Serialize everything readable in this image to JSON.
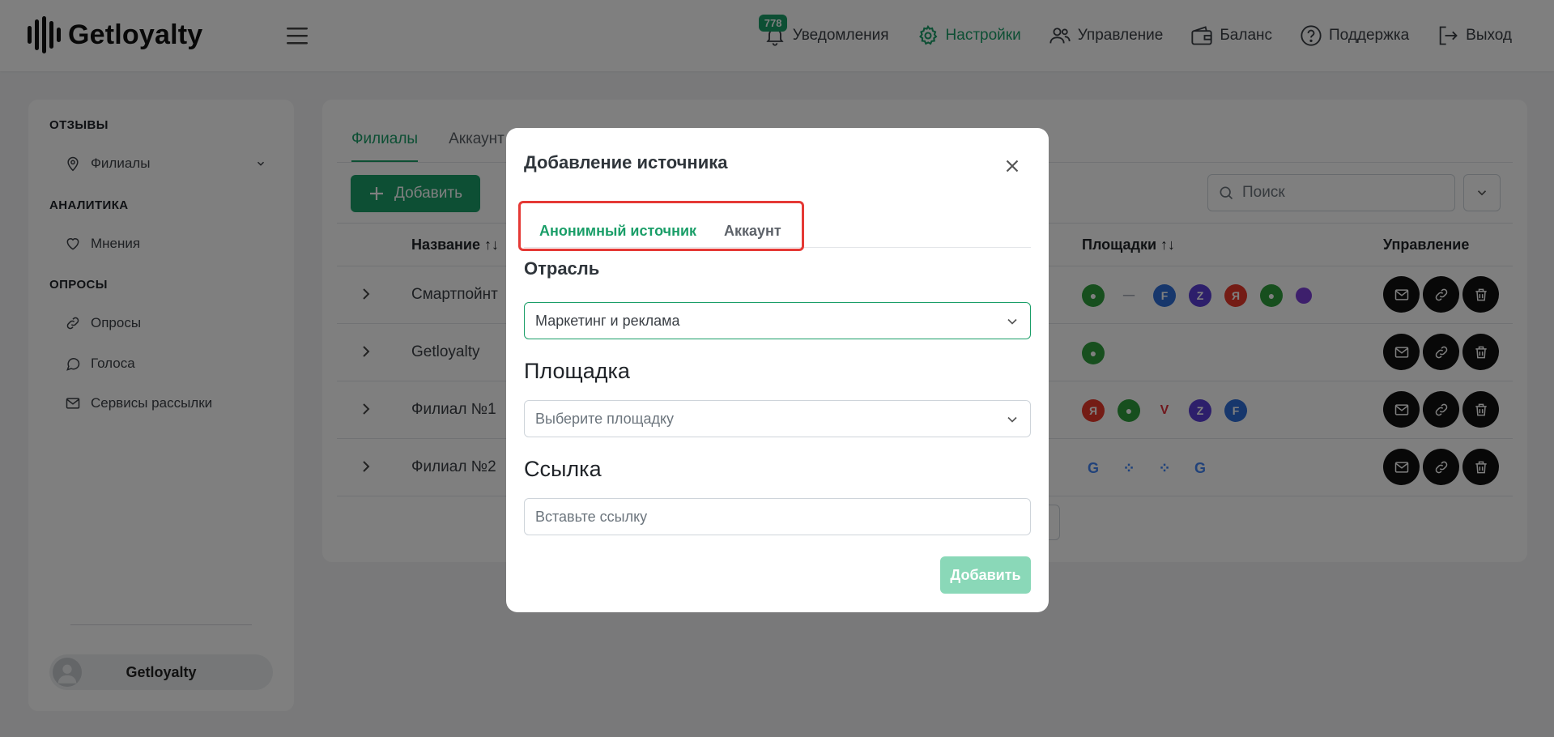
{
  "header": {
    "logo_text": "Getloyalty",
    "nav": [
      {
        "label": "Уведомления",
        "icon": "bell-icon",
        "badge": "778"
      },
      {
        "label": "Настройки",
        "icon": "gear-icon",
        "active": true
      },
      {
        "label": "Управление",
        "icon": "users-icon"
      },
      {
        "label": "Баланс",
        "icon": "wallet-icon"
      },
      {
        "label": "Поддержка",
        "icon": "help-icon"
      },
      {
        "label": "Выход",
        "icon": "logout-icon"
      }
    ]
  },
  "sidebar": {
    "sections": [
      {
        "title": "ОТЗЫВЫ",
        "items": [
          {
            "label": "Филиалы",
            "icon": "map-pin-icon"
          }
        ]
      },
      {
        "title": "АНАЛИТИКА",
        "items": [
          {
            "label": "Мнения",
            "icon": "heart-icon"
          }
        ]
      },
      {
        "title": "ОПРОСЫ",
        "items": [
          {
            "label": "Опросы",
            "icon": "link-icon"
          },
          {
            "label": "Голоса",
            "icon": "chat-icon"
          },
          {
            "label": "Сервисы рассылки",
            "icon": "mail-icon"
          }
        ]
      }
    ],
    "user_name": "Getloyalty"
  },
  "main": {
    "tabs": [
      "Филиалы",
      "Аккаунт"
    ],
    "add_label": "Добавить",
    "search_placeholder": "Поиск",
    "columns": {
      "name": "Название ↑↓",
      "platforms": "Площадки ↑↓",
      "actions": "Управление"
    },
    "rows": [
      {
        "name": "Смартпойнт",
        "platforms": [
          "green",
          "gray-line",
          "blue-f",
          "purple-z",
          "red-ya",
          "green",
          "purple-orb"
        ]
      },
      {
        "name": "Getloyalty",
        "platforms": [
          "green"
        ]
      },
      {
        "name": "Филиал №1",
        "platforms": [
          "red-ya",
          "green",
          "red-v",
          "purple-z",
          "blue-f"
        ]
      },
      {
        "name": "Филиал №2",
        "platforms": [
          "google",
          "dots",
          "dots",
          "google"
        ]
      }
    ]
  },
  "modal": {
    "title": "Добавление источника",
    "tabs": {
      "anon": "Анонимный источник",
      "account": "Аккаунт"
    },
    "industry_label": "Отрасль",
    "industry_value": "Маркетинг и реклама",
    "platform_label": "Площадка",
    "platform_placeholder": "Выберите площадку",
    "link_label": "Ссылка",
    "link_placeholder": "Вставьте ссылку",
    "submit_label": "Добавить"
  },
  "colors": {
    "accent": "#1a9e68",
    "highlight": "#e53935"
  }
}
